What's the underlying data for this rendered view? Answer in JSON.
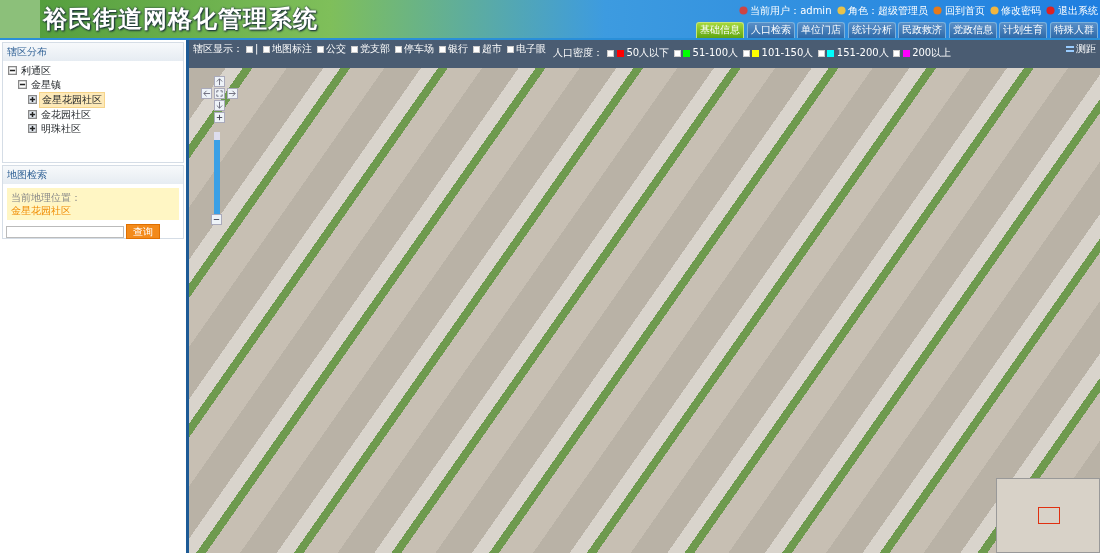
{
  "header": {
    "title": "裕民街道网格化管理系统",
    "user_links": [
      {
        "kind": "user",
        "text": "当前用户：admin"
      },
      {
        "kind": "role",
        "text": "角色：超级管理员"
      },
      {
        "kind": "home",
        "text": "回到首页"
      },
      {
        "kind": "password",
        "text": "修改密码"
      },
      {
        "kind": "logout",
        "text": "退出系统"
      }
    ]
  },
  "tabs": [
    {
      "label": "基础信息",
      "selected": true
    },
    {
      "label": "人口检索",
      "selected": false
    },
    {
      "label": "单位门店",
      "selected": false
    },
    {
      "label": "统计分析",
      "selected": false
    },
    {
      "label": "民政救济",
      "selected": false
    },
    {
      "label": "党政信息",
      "selected": false
    },
    {
      "label": "计划生育",
      "selected": false
    },
    {
      "label": "特殊人群",
      "selected": false
    }
  ],
  "sidebar": {
    "district_panel": {
      "title": "辖区分布",
      "tree": [
        {
          "label": "利通区",
          "expanded": true,
          "selected": false,
          "children": [
            {
              "label": "金星镇",
              "expanded": true,
              "selected": false,
              "children": [
                {
                  "label": "金星花园社区",
                  "expanded": false,
                  "selected": true
                },
                {
                  "label": "金花园社区",
                  "expanded": false,
                  "selected": false
                },
                {
                  "label": "明珠社区",
                  "expanded": false,
                  "selected": false
                }
              ]
            }
          ]
        }
      ]
    },
    "search_panel": {
      "title": "地图检索",
      "location_label": "当前地理位置：",
      "location_value": "金星花园社区",
      "button": "查询"
    }
  },
  "map_toolbar": {
    "layers_label": "辖区显示：",
    "layers_checked": false,
    "separator": "|",
    "layers": [
      {
        "label": "地图标注",
        "checked": false
      },
      {
        "label": "公交",
        "checked": false
      },
      {
        "label": "党支部",
        "checked": false
      },
      {
        "label": "停车场",
        "checked": false
      },
      {
        "label": "银行",
        "checked": false
      },
      {
        "label": "超市",
        "checked": false
      },
      {
        "label": "电子眼",
        "checked": false
      }
    ],
    "density_label": "人口密度：",
    "density": [
      {
        "label": "50人以下",
        "color": "#ff0000",
        "checked": false
      },
      {
        "label": "51-100人",
        "color": "#00ff00",
        "checked": false
      },
      {
        "label": "101-150人",
        "color": "#ffff00",
        "checked": false
      },
      {
        "label": "151-200人",
        "color": "#00ffff",
        "checked": false
      },
      {
        "label": "200以上",
        "color": "#ff00ff",
        "checked": false
      }
    ],
    "measure": "测距"
  },
  "map": {
    "zoom": {
      "level": 0.9
    }
  }
}
